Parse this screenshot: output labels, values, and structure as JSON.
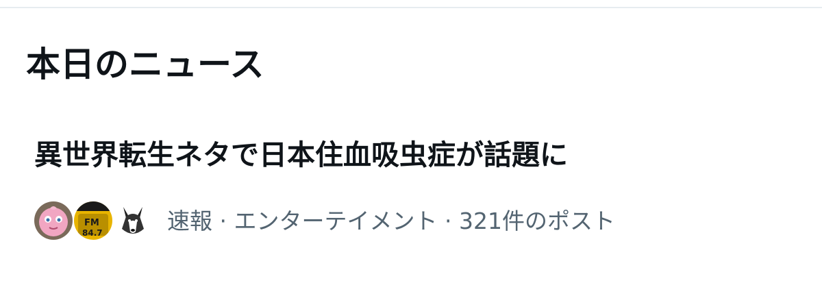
{
  "section": {
    "title": "本日のニュース"
  },
  "news_item": {
    "headline": "異世界転生ネタで日本住血吸虫症が話題に",
    "category": "速報",
    "subcategory": "エンターテイメント",
    "post_count": "321件のポスト",
    "separator": " · ",
    "avatar_text": {
      "fm_label": "FM",
      "fm_frequency": "84.7"
    }
  },
  "colors": {
    "text_primary": "#0f1419",
    "text_secondary": "#536471",
    "divider": "#e6ecf0"
  }
}
